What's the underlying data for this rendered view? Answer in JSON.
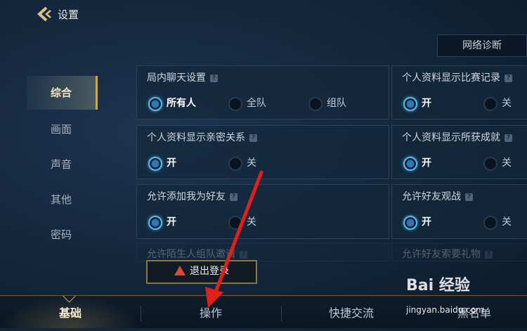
{
  "header": {
    "title": "设置",
    "back_icon": "chevron-left-icon"
  },
  "network_diagnosis_label": "网络诊断",
  "sidebar": {
    "items": [
      {
        "label": "综合",
        "active": true
      },
      {
        "label": "画面",
        "active": false
      },
      {
        "label": "声音",
        "active": false
      },
      {
        "label": "其他",
        "active": false
      },
      {
        "label": "密码",
        "active": false
      }
    ]
  },
  "settings": {
    "chat": {
      "title": "局内聊天设置",
      "options": [
        "所有人",
        "全队",
        "组队"
      ],
      "selected": "所有人"
    },
    "match_record": {
      "title": "个人资料显示比赛记录",
      "options": [
        "开",
        "关"
      ],
      "selected": "开"
    },
    "intimate": {
      "title": "个人资料显示亲密关系",
      "options": [
        "开",
        "关"
      ],
      "selected": "开"
    },
    "achievements": {
      "title": "个人资料显示所获成就",
      "options": [
        "开",
        "关"
      ],
      "selected": "开"
    },
    "add_friend": {
      "title": "允许添加我为好友",
      "options": [
        "开",
        "关"
      ],
      "selected": "开"
    },
    "spectate": {
      "title": "允许好友观战",
      "options": [
        "开",
        "关"
      ],
      "selected": "开"
    },
    "stranger_team": {
      "title": "允许陌生人组队邀请"
    },
    "gift_request": {
      "title": "允许好友索要礼物"
    }
  },
  "logout_label": "退出登录",
  "bottom_tabs": [
    {
      "label": "基础",
      "active": true
    },
    {
      "label": "操作",
      "active": false
    },
    {
      "label": "快捷交流",
      "active": false
    },
    {
      "label": "黑名单",
      "active": false
    }
  ],
  "watermark": {
    "logo_text": "Bai 经验",
    "url": "jingyan.baidu.com"
  },
  "colors": {
    "accent_gold": "#c9a75e",
    "radio_on": "#5fb9e8",
    "arrow_red": "#e0201a",
    "warning_red": "#e0453a"
  }
}
